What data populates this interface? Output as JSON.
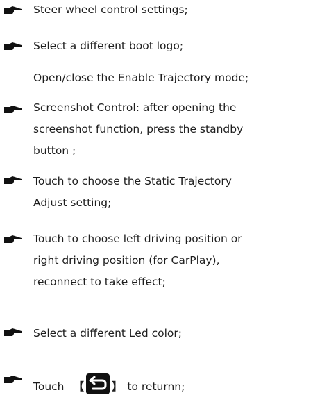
{
  "items": [
    {
      "lines": [
        "Steer wheel control settings;"
      ],
      "has_icon": true
    },
    {
      "lines": [
        "Select a different boot logo;"
      ],
      "has_icon": true
    },
    {
      "lines": [
        "Open/close the Enable Trajectory mode;"
      ],
      "has_icon": false
    },
    {
      "lines": [
        "Screenshot Control: after opening the",
        "screenshot function, press the standby",
        "button ;"
      ],
      "has_icon": true
    },
    {
      "lines": [
        "Touch to choose the Static Trajectory",
        "Adjust setting;"
      ],
      "has_icon": true
    },
    {
      "lines": [
        "Touch to choose left driving position or",
        "right driving position (for CarPlay),",
        "reconnect to take effect;"
      ],
      "has_icon": true
    },
    {
      "lines": [
        "Select a different Led color;"
      ],
      "has_icon": true
    }
  ],
  "last_item": {
    "before": "Touch",
    "bracket_open": "【",
    "icon": "return-arrow-icon",
    "bracket_close": "】",
    "after": "to returnn;"
  },
  "bullet_icon": "pointing-hand-icon"
}
